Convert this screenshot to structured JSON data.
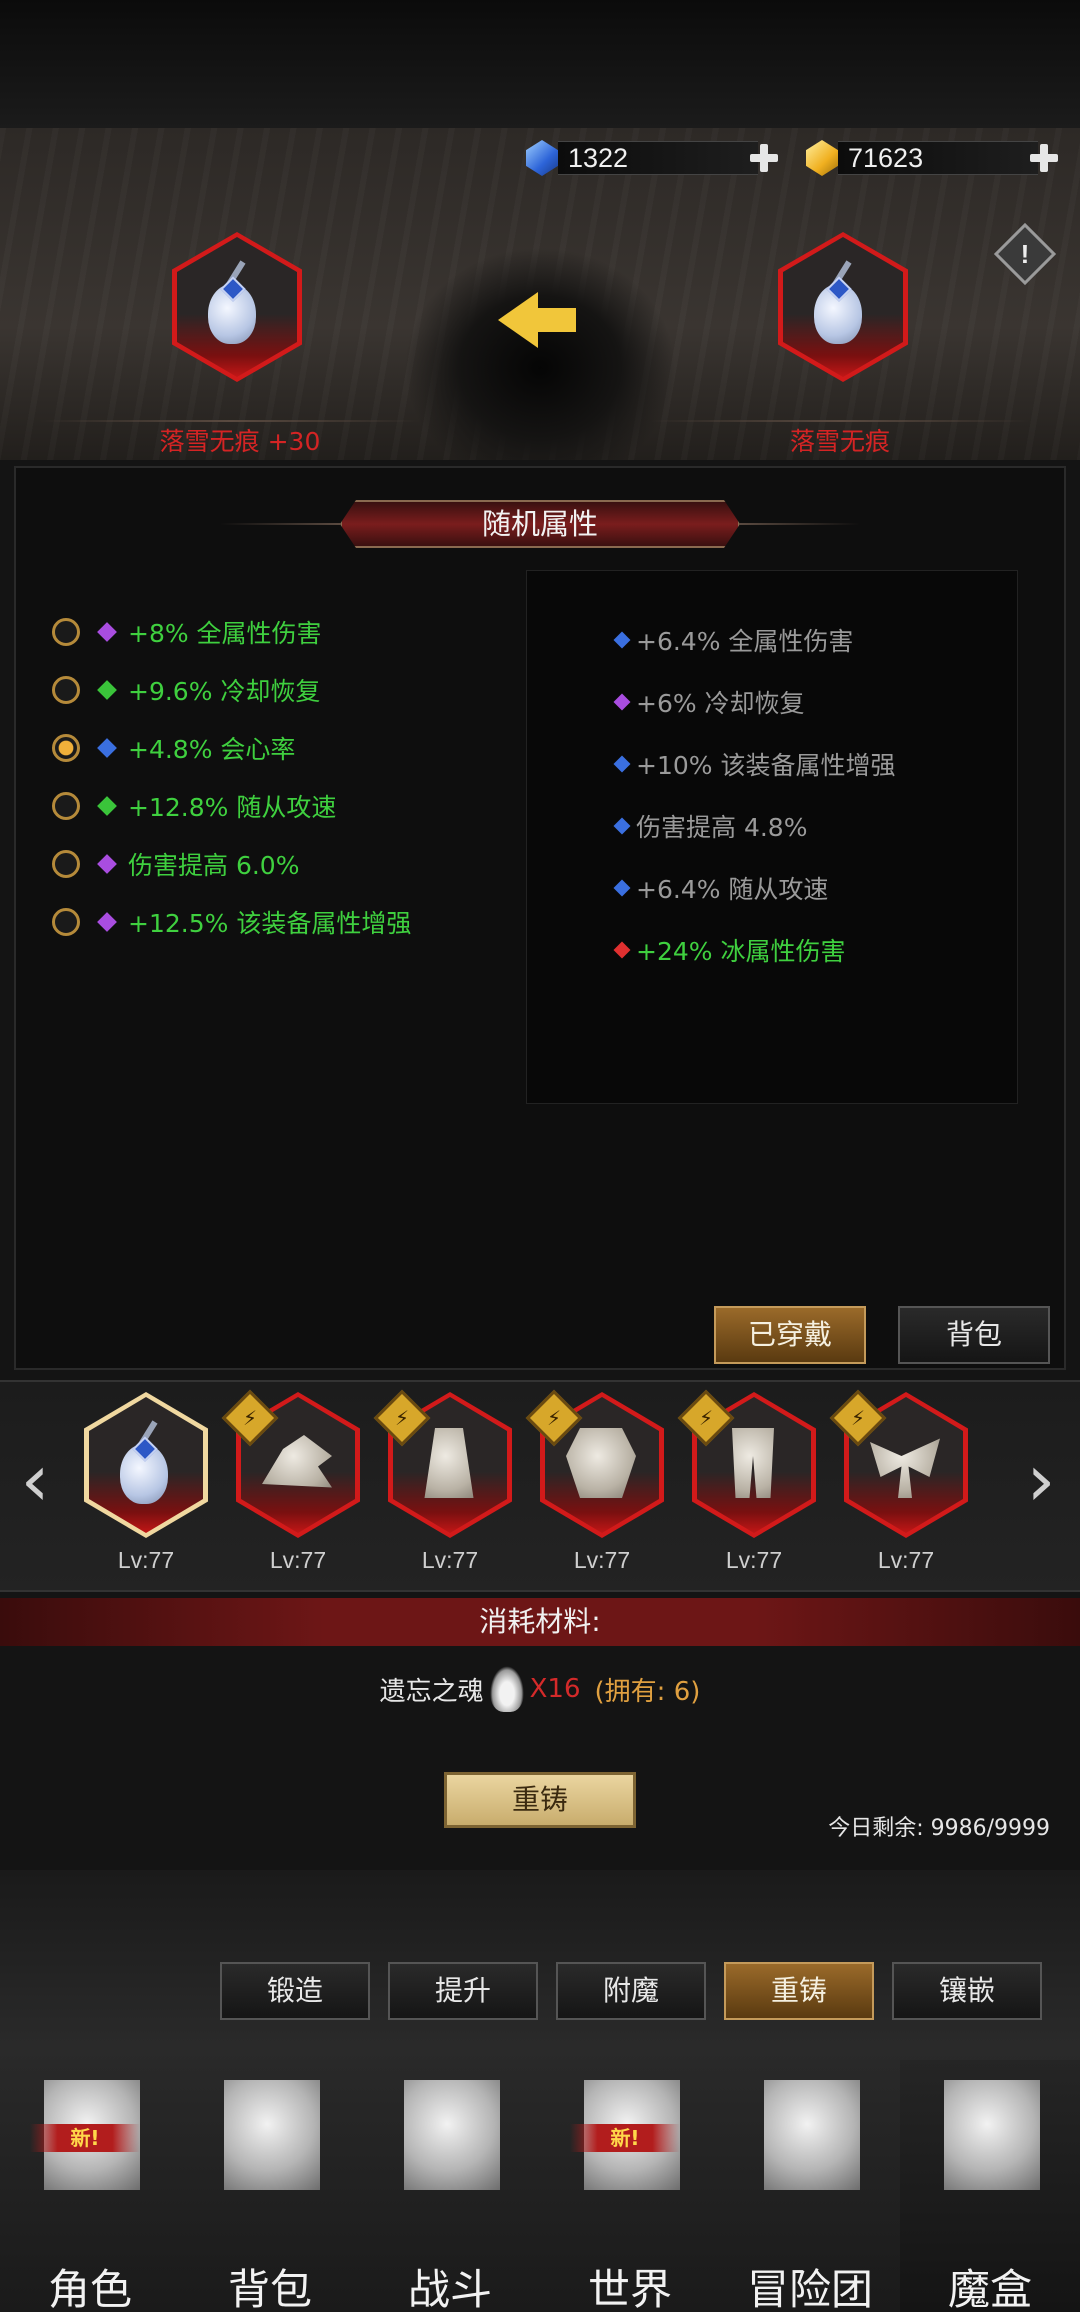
{
  "currency": {
    "gems": "1322",
    "gold": "71623",
    "gem_color": "#3a7fe0",
    "gold_color": "#f0c030"
  },
  "compare": {
    "left_item_name": "落雪无痕 +30",
    "right_item_name": "落雪无痕"
  },
  "section_title": "随机属性",
  "current_attrs": [
    {
      "text": "+8% 全属性伤害",
      "gem_color": "#a94de0",
      "selected": false
    },
    {
      "text": "+9.6% 冷却恢复",
      "gem_color": "#3ac43a",
      "selected": false
    },
    {
      "text": "+4.8% 会心率",
      "gem_color": "#3a6fe0",
      "selected": true
    },
    {
      "text": "+12.8% 随从攻速",
      "gem_color": "#3ac43a",
      "selected": false
    },
    {
      "text": "伤害提高 6.0%",
      "gem_color": "#a94de0",
      "selected": false
    },
    {
      "text": "+12.5% 该装备属性增强",
      "gem_color": "#a94de0",
      "selected": false
    }
  ],
  "new_attrs": [
    {
      "text": "+6.4% 全属性伤害",
      "gem_color": "#3a6fe0",
      "color": "#9a9a9a"
    },
    {
      "text": "+6% 冷却恢复",
      "gem_color": "#a94de0",
      "color": "#9a9a9a"
    },
    {
      "text": "+10% 该装备属性增强",
      "gem_color": "#3a6fe0",
      "color": "#9a9a9a"
    },
    {
      "text": "伤害提高 4.8%",
      "gem_color": "#3a6fe0",
      "color": "#9a9a9a"
    },
    {
      "text": "+6.4% 随从攻速",
      "gem_color": "#3a6fe0",
      "color": "#9a9a9a"
    },
    {
      "text": "+24% 冰属性伤害",
      "gem_color": "#e03030",
      "color": "#3fd03f"
    }
  ],
  "filter_tabs": {
    "equipped": "已穿戴",
    "backpack": "背包"
  },
  "equipment": [
    {
      "level": "Lv:77",
      "icon": "scepter-icon",
      "badge": false,
      "selected": true
    },
    {
      "level": "Lv:77",
      "icon": "hat-icon",
      "badge": true,
      "selected": false
    },
    {
      "level": "Lv:77",
      "icon": "robe-icon",
      "badge": true,
      "selected": false
    },
    {
      "level": "Lv:77",
      "icon": "chest-armor-icon",
      "badge": true,
      "selected": false
    },
    {
      "level": "Lv:77",
      "icon": "leg-armor-icon",
      "badge": true,
      "selected": false
    },
    {
      "level": "Lv:77",
      "icon": "ribbon-icon",
      "badge": true,
      "selected": false
    }
  ],
  "materials": {
    "header": "消耗材料:",
    "name": "遗忘之魂",
    "amount": "X16",
    "owned": "(拥有: 6)"
  },
  "reforge_button": "重铸",
  "remaining": "今日剩余: 9986/9999",
  "tabs": [
    {
      "label": "锻造",
      "active": false
    },
    {
      "label": "提升",
      "active": false
    },
    {
      "label": "附魔",
      "active": false
    },
    {
      "label": "重铸",
      "active": true
    },
    {
      "label": "镶嵌",
      "active": false
    }
  ],
  "bottom_nav": [
    {
      "label": "角色",
      "icon": "helmet-icon",
      "new": true
    },
    {
      "label": "背包",
      "icon": "backpack-icon",
      "new": false
    },
    {
      "label": "战斗",
      "icon": "shield-sword-icon",
      "new": false
    },
    {
      "label": "世界",
      "icon": "scroll-map-icon",
      "new": true
    },
    {
      "label": "冒险团",
      "icon": "castle-icon",
      "new": false
    },
    {
      "label": "魔盒",
      "icon": "cube-icon",
      "new": false,
      "active": true
    }
  ],
  "new_badge_text": "新!"
}
